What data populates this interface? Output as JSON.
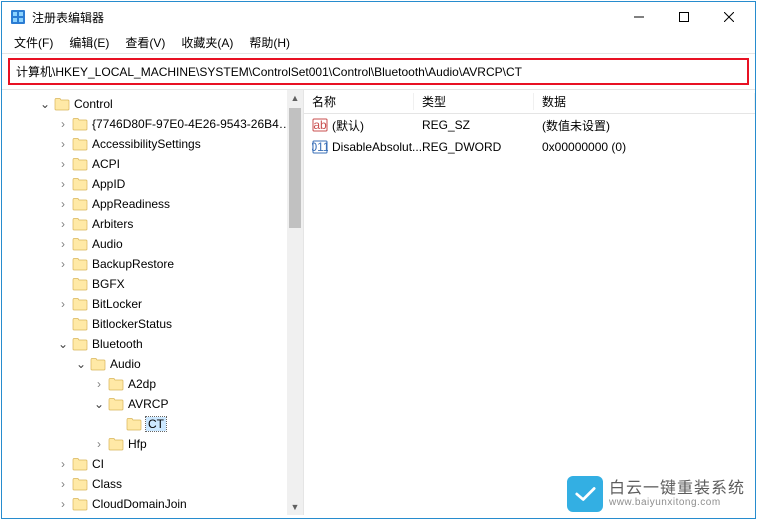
{
  "window": {
    "title": "注册表编辑器"
  },
  "menu": {
    "file": "文件(F)",
    "edit": "编辑(E)",
    "view": "查看(V)",
    "favorites": "收藏夹(A)",
    "help": "帮助(H)"
  },
  "address": "计算机\\HKEY_LOCAL_MACHINE\\SYSTEM\\ControlSet001\\Control\\Bluetooth\\Audio\\AVRCP\\CT",
  "tree": [
    {
      "indent": 2,
      "expander": "v",
      "label": "Control"
    },
    {
      "indent": 3,
      "expander": ">",
      "label": "{7746D80F-97E0-4E26-9543-26B4…"
    },
    {
      "indent": 3,
      "expander": ">",
      "label": "AccessibilitySettings"
    },
    {
      "indent": 3,
      "expander": ">",
      "label": "ACPI"
    },
    {
      "indent": 3,
      "expander": ">",
      "label": "AppID"
    },
    {
      "indent": 3,
      "expander": ">",
      "label": "AppReadiness"
    },
    {
      "indent": 3,
      "expander": ">",
      "label": "Arbiters"
    },
    {
      "indent": 3,
      "expander": ">",
      "label": "Audio"
    },
    {
      "indent": 3,
      "expander": ">",
      "label": "BackupRestore"
    },
    {
      "indent": 3,
      "expander": "",
      "label": "BGFX"
    },
    {
      "indent": 3,
      "expander": ">",
      "label": "BitLocker"
    },
    {
      "indent": 3,
      "expander": "",
      "label": "BitlockerStatus"
    },
    {
      "indent": 3,
      "expander": "v",
      "label": "Bluetooth"
    },
    {
      "indent": 4,
      "expander": "v",
      "label": "Audio"
    },
    {
      "indent": 5,
      "expander": ">",
      "label": "A2dp"
    },
    {
      "indent": 5,
      "expander": "v",
      "label": "AVRCP"
    },
    {
      "indent": 6,
      "expander": "",
      "label": "CT",
      "selected": true
    },
    {
      "indent": 5,
      "expander": ">",
      "label": "Hfp"
    },
    {
      "indent": 3,
      "expander": ">",
      "label": "CI"
    },
    {
      "indent": 3,
      "expander": ">",
      "label": "Class"
    },
    {
      "indent": 3,
      "expander": ">",
      "label": "CloudDomainJoin"
    }
  ],
  "list": {
    "headers": {
      "name": "名称",
      "type": "类型",
      "data": "数据"
    },
    "rows": [
      {
        "icon": "string",
        "name": "(默认)",
        "type": "REG_SZ",
        "data": "(数值未设置)"
      },
      {
        "icon": "binary",
        "name": "DisableAbsolut...",
        "type": "REG_DWORD",
        "data": "0x00000000 (0)"
      }
    ]
  },
  "watermark": {
    "cn": "白云一键重装系统",
    "url": "www.baiyunxitong.com"
  }
}
